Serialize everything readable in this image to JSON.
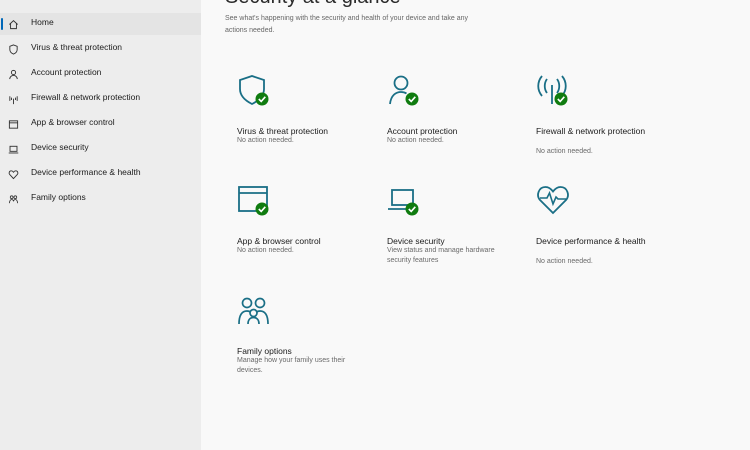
{
  "sidebar": {
    "items": [
      {
        "label": "Home",
        "icon": "home-icon"
      },
      {
        "label": "Virus & threat protection",
        "icon": "shield-icon"
      },
      {
        "label": "Account protection",
        "icon": "person-icon"
      },
      {
        "label": "Firewall & network protection",
        "icon": "antenna-icon"
      },
      {
        "label": "App & browser control",
        "icon": "window-icon"
      },
      {
        "label": "Device security",
        "icon": "laptop-icon"
      },
      {
        "label": "Device performance & health",
        "icon": "heart-icon"
      },
      {
        "label": "Family options",
        "icon": "family-icon"
      }
    ]
  },
  "header": {
    "title": "Security at a glance",
    "description": "See what's happening with the security and health of your device and take any actions needed."
  },
  "tiles": [
    {
      "title": "Virus & threat protection",
      "status": "No action needed.",
      "icon": "shield-check-icon"
    },
    {
      "title": "Account protection",
      "status": "No action needed.",
      "icon": "person-check-icon"
    },
    {
      "title": "Firewall & network protection",
      "status": "No action needed.",
      "icon": "antenna-check-icon"
    },
    {
      "title": "App & browser control",
      "status": "No action needed.",
      "icon": "window-check-icon"
    },
    {
      "title": "Device security",
      "status": "View status and manage hardware security features",
      "icon": "laptop-check-icon"
    },
    {
      "title": "Device performance & health",
      "status": "No action needed.",
      "icon": "heart-pulse-icon"
    },
    {
      "title": "Family options",
      "status": "Manage how your family uses their devices.",
      "icon": "family-icon"
    }
  ],
  "colors": {
    "accent": "#0067b8",
    "icon_teal": "#1a6f86",
    "status_ok": "#107c10",
    "sidebar_bg": "#ededed",
    "main_bg": "#f9f9f9"
  }
}
